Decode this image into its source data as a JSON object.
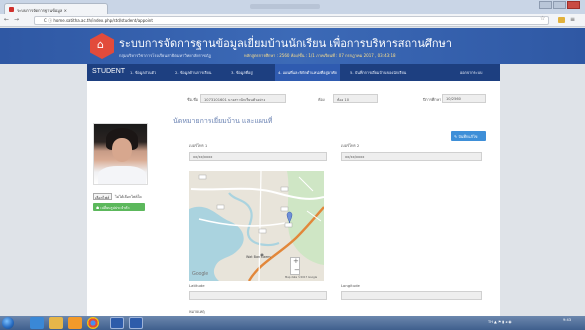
{
  "browser": {
    "tab_title": "ระบบการจัดการฐานข้อมูล ×",
    "url": "C  ⓘ home.satitha.ac.th/index.php/std/student/appoint"
  },
  "header": {
    "site_title": "ระบบการจัดการฐานข้อมูลเยี่ยมบ้านนักเรียน เพื่อการบริหารสถานศึกษา",
    "site_subtitle": "กลุ่มบริหารวิชาการโรงเรียนสาธิตมหาวิทยาลัยราชภัฏ",
    "school_info": "หลักสูตรการศึกษา : 2560  ห้อง/ชั้น : 1/1  ภาคเรียนที่ : 07 กรกฎาคม 2017 , 03:43:18"
  },
  "nav": {
    "brand": "STUDENT",
    "items": [
      {
        "label": "1. ข้อมูลส่วนตัว"
      },
      {
        "label": "2. ข้อมูลด้านการเรียน"
      },
      {
        "label": "3. ข้อมูลที่อยู่"
      },
      {
        "label": "4. แผนที่และพิกัดตำแหน่งที่อยู่อาศัย"
      },
      {
        "label": "5. บันทึกการเยี่ยมบ้านของนักเรียน"
      },
      {
        "label": "ออกจากระบบ"
      }
    ]
  },
  "profile": {
    "choose_file_label": "เลือกไฟล์",
    "file_status": "ไม่ได้เลือกไฟล์ใด",
    "upload_label": "☗ เปลี่ยนรูปประจำตัว"
  },
  "form": {
    "name_label": "ชื่อ-ชื่อ",
    "name_value": "1073101601  นางสาวนักเรียนตัวอย่าง",
    "room_label": "ห้อง",
    "room_value": "ห้อง 10",
    "class_label": "ปีการศึกษา",
    "class_value": "10/2560",
    "section_title": "นัดหมายการเยี่ยมบ้าน และแผนที่",
    "save_label": "✎ บันทึกแก้ไข",
    "phone1_label": "เบอร์โทร 1",
    "phone1_placeholder": "xx/xx/xxxx",
    "phone2_label": "เบอร์โทร 2",
    "phone2_placeholder": "xx/xx/xxxx",
    "latitude_label": "Latitude",
    "longitude_label": "Longitude",
    "note_label": "หมายเหตุ"
  },
  "map": {
    "place_label": "Wat Ban Laem",
    "google_label": "Google",
    "attribution": "Map data ©2017 Google",
    "zoom_in": "+",
    "zoom_out": "−",
    "accent_color": "#e2873a"
  },
  "taskbar": {
    "tray_text": "TH ▲ ⚑ ▮ ◂ ◉",
    "clock": "9:43"
  }
}
